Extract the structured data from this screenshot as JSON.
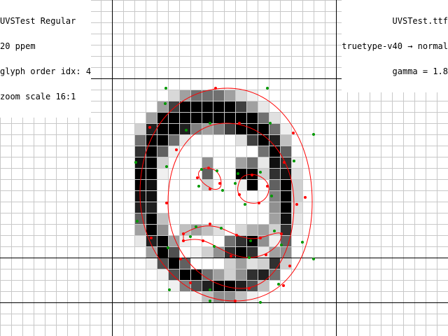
{
  "header": {
    "left": {
      "font_name": "UVSTest Regular",
      "ppem": "20 ppem",
      "glyph_index": "glyph order idx: 4",
      "zoom": "zoom scale 16:1"
    },
    "right": {
      "file_name": "UVSTest.ttf",
      "hinting": "truetype-v40 → normal",
      "gamma": "gamma = 1.8"
    }
  },
  "view": {
    "zoom_factor": 16,
    "ppem": 20,
    "gamma": 1.8,
    "colors": {
      "background": "#ffffff",
      "grid": "#c8c8c8",
      "axis": "#000000",
      "outline": "#ff0000",
      "on_point": "#ff0000",
      "off_point": "#009900"
    }
  },
  "glyph": {
    "description": "smiley face glyph rendered in grayscale pixels",
    "pixel_rows": [
      "",
      "",
      "",
      "",
      "",
      "",
      "",
      "",
      ""
    ]
  }
}
